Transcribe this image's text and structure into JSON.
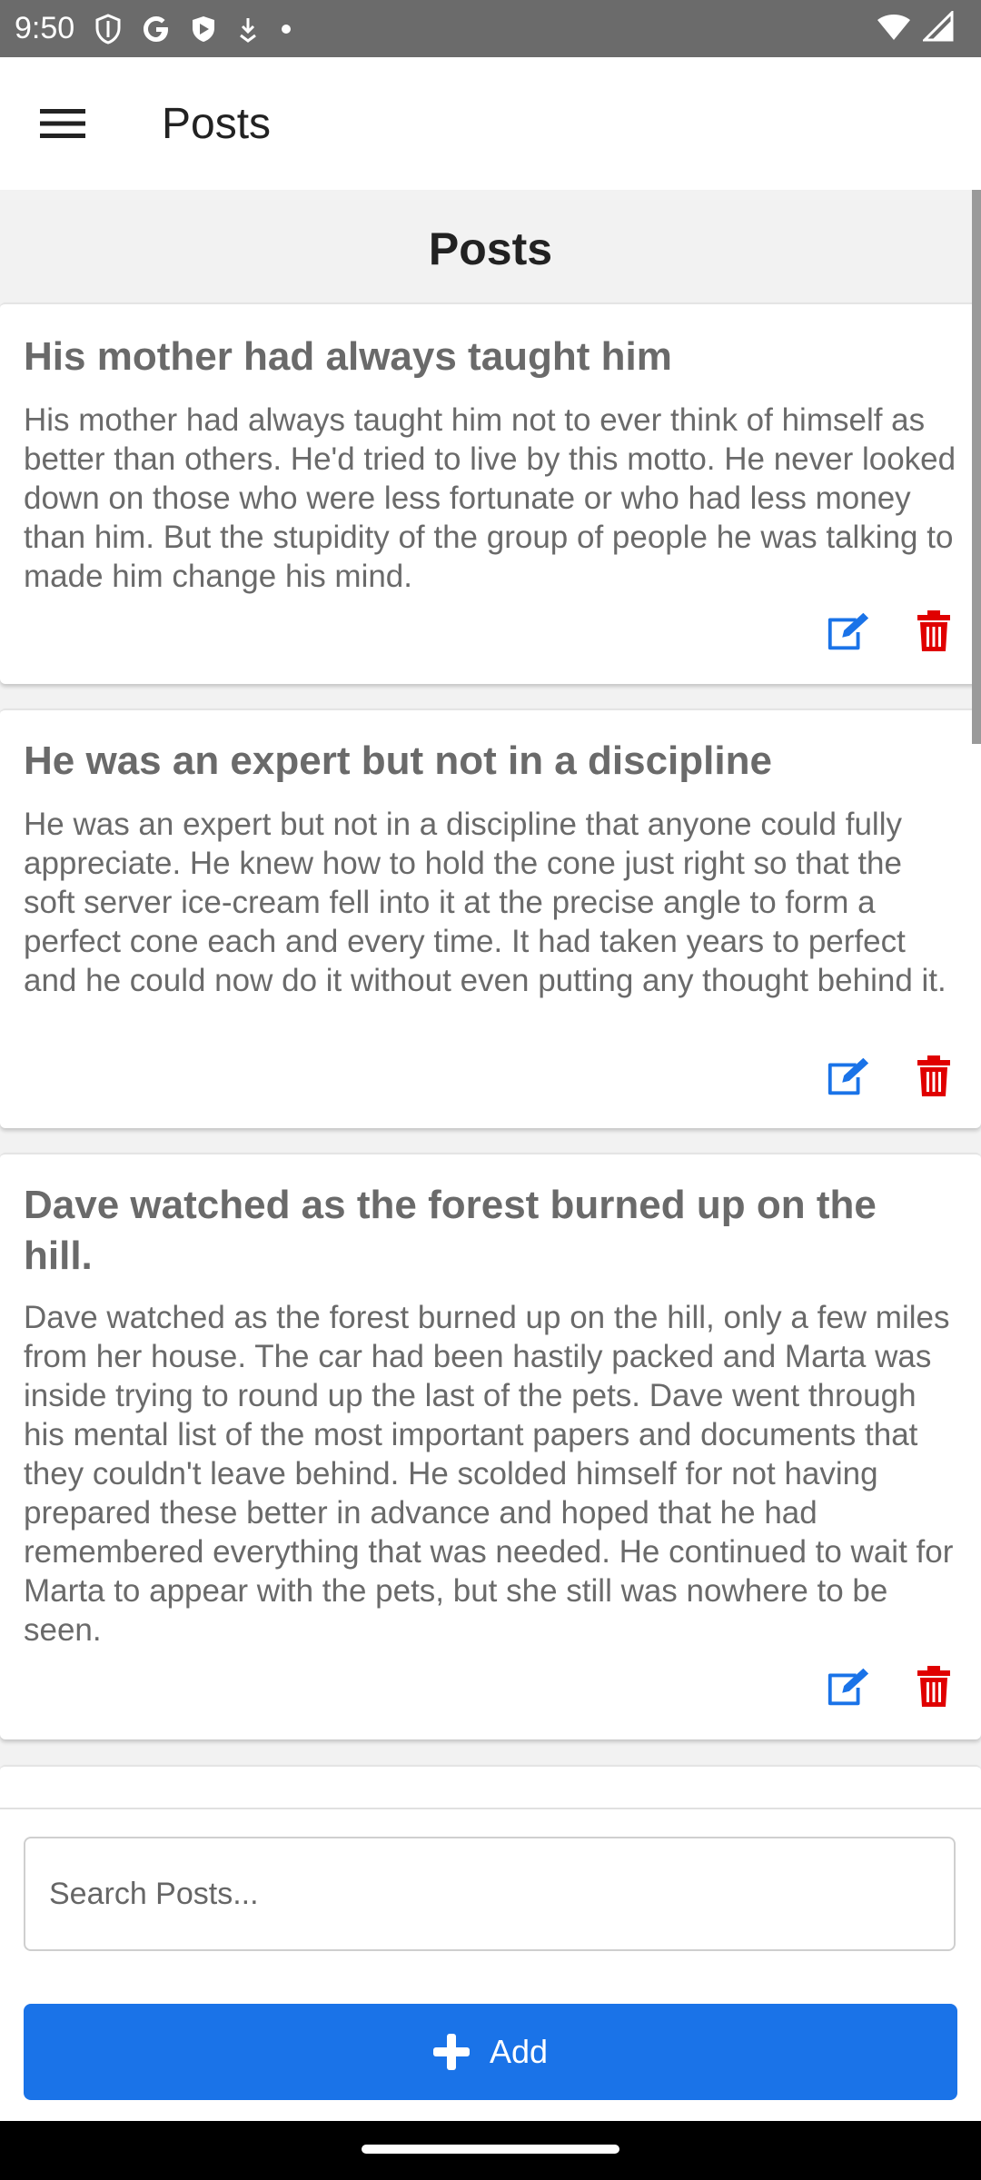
{
  "status_bar": {
    "time": "9:50"
  },
  "app_bar": {
    "title": "Posts"
  },
  "main": {
    "heading": "Posts",
    "posts": [
      {
        "title": "His mother had always taught him",
        "body": "His mother had always taught him not to ever think of himself as better than others. He'd tried to live by this motto. He never looked down on those who were less fortunate or who had less money than him. But the stupidity of the group of people he was talking to made him change his mind."
      },
      {
        "title": "He was an expert but not in a discipline",
        "body": "He was an expert but not in a discipline that anyone could fully appreciate. He knew how to hold the cone just right so that the soft server ice-cream fell into it at the precise angle to form a perfect cone each and every time. It had taken years to perfect and he could now do it without even putting any thought behind it."
      },
      {
        "title": "Dave watched as the forest burned up on the hill.",
        "body": "Dave watched as the forest burned up on the hill, only a few miles from her house. The car had been hastily packed and Marta was inside trying to round up the last of the pets. Dave went through his mental list of the most important papers and documents that they couldn't leave behind. He scolded himself for not having prepared these better in advance and hoped that he had remembered everything that was needed. He continued to wait for Marta to appear with the pets, but she still was nowhere to be seen."
      }
    ]
  },
  "bottom": {
    "search_placeholder": "Search Posts...",
    "add_label": "Add"
  },
  "colors": {
    "accent": "#1a73e8",
    "delete": "#e00000",
    "edit": "#1a73e8"
  }
}
